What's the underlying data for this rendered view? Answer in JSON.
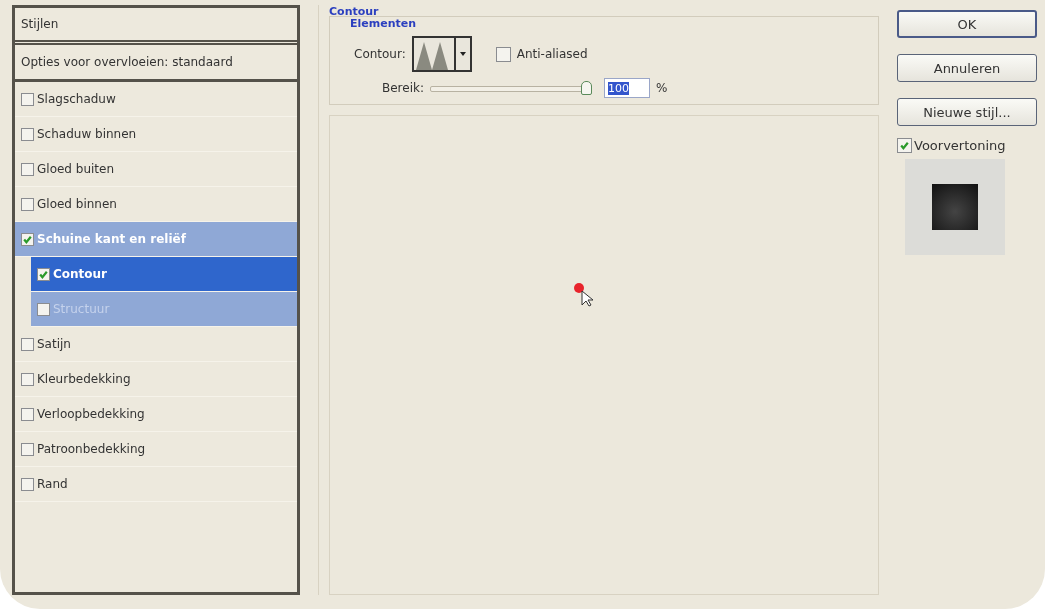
{
  "styles_panel": {
    "header": "Stijlen",
    "blending_options": "Opties voor overvloeien: standaard",
    "items": [
      {
        "label": "Slagschaduw",
        "checked": false,
        "selected": false,
        "disabled": false
      },
      {
        "label": "Schaduw binnen",
        "checked": false,
        "selected": false,
        "disabled": false
      },
      {
        "label": "Gloed buiten",
        "checked": false,
        "selected": false,
        "disabled": false
      },
      {
        "label": "Gloed binnen",
        "checked": false,
        "selected": false,
        "disabled": false
      },
      {
        "label": "Schuine kant en reliëf",
        "checked": true,
        "selected": false,
        "disabled": false,
        "expanded": true,
        "children": [
          {
            "label": "Contour",
            "checked": true,
            "selected": true,
            "disabled": false
          },
          {
            "label": "Structuur",
            "checked": false,
            "selected": false,
            "disabled": true
          }
        ]
      },
      {
        "label": "Satijn",
        "checked": false,
        "selected": false,
        "disabled": false
      },
      {
        "label": "Kleurbedekking",
        "checked": false,
        "selected": false,
        "disabled": false
      },
      {
        "label": "Verloopbedekking",
        "checked": false,
        "selected": false,
        "disabled": false
      },
      {
        "label": "Patroonbedekking",
        "checked": false,
        "selected": false,
        "disabled": false
      },
      {
        "label": "Rand",
        "checked": false,
        "selected": false,
        "disabled": false
      }
    ]
  },
  "contour_group": {
    "title": "Contour",
    "subgroup_title": "Elementen",
    "contour_label": "Contour:",
    "anti_aliased": {
      "label": "Anti-aliased",
      "checked": false
    },
    "range": {
      "label": "Bereik:",
      "level": 1,
      "value": "100",
      "unit": "%"
    }
  },
  "buttons": [
    "OK",
    "Annuleren",
    "Nieuwe stijl..."
  ],
  "preview": {
    "label": "Voorvertoning",
    "checked": true
  }
}
